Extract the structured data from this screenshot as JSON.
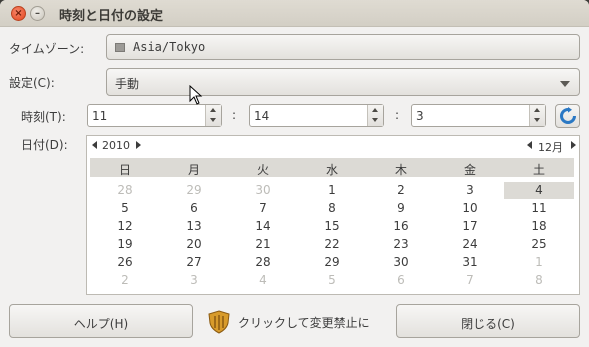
{
  "window": {
    "title": "時刻と日付の設定"
  },
  "timezone": {
    "label": "タイムゾーン:",
    "value": "Asia/Tokyo"
  },
  "setting": {
    "label": "設定(C):",
    "value": "手動"
  },
  "time": {
    "label": "時刻(T):",
    "hours": "11",
    "minutes": "14",
    "seconds": "3",
    "separator": ":"
  },
  "date": {
    "label": "日付(D):"
  },
  "calendar": {
    "year": "2010",
    "month": "12月",
    "weekdays": [
      "日",
      "月",
      "火",
      "水",
      "木",
      "金",
      "土"
    ],
    "selected_day": "4",
    "weeks": [
      [
        {
          "d": "28",
          "o": 1
        },
        {
          "d": "29",
          "o": 1
        },
        {
          "d": "30",
          "o": 1
        },
        {
          "d": "1",
          "o": 0
        },
        {
          "d": "2",
          "o": 0
        },
        {
          "d": "3",
          "o": 0
        },
        {
          "d": "4",
          "o": 0
        }
      ],
      [
        {
          "d": "5",
          "o": 0
        },
        {
          "d": "6",
          "o": 0
        },
        {
          "d": "7",
          "o": 0
        },
        {
          "d": "8",
          "o": 0
        },
        {
          "d": "9",
          "o": 0
        },
        {
          "d": "10",
          "o": 0
        },
        {
          "d": "11",
          "o": 0
        }
      ],
      [
        {
          "d": "12",
          "o": 0
        },
        {
          "d": "13",
          "o": 0
        },
        {
          "d": "14",
          "o": 0
        },
        {
          "d": "15",
          "o": 0
        },
        {
          "d": "16",
          "o": 0
        },
        {
          "d": "17",
          "o": 0
        },
        {
          "d": "18",
          "o": 0
        }
      ],
      [
        {
          "d": "19",
          "o": 0
        },
        {
          "d": "20",
          "o": 0
        },
        {
          "d": "21",
          "o": 0
        },
        {
          "d": "22",
          "o": 0
        },
        {
          "d": "23",
          "o": 0
        },
        {
          "d": "24",
          "o": 0
        },
        {
          "d": "25",
          "o": 0
        }
      ],
      [
        {
          "d": "26",
          "o": 0
        },
        {
          "d": "27",
          "o": 0
        },
        {
          "d": "28",
          "o": 0
        },
        {
          "d": "29",
          "o": 0
        },
        {
          "d": "30",
          "o": 0
        },
        {
          "d": "31",
          "o": 0
        },
        {
          "d": "1",
          "o": 1
        }
      ],
      [
        {
          "d": "2",
          "o": 1
        },
        {
          "d": "3",
          "o": 1
        },
        {
          "d": "4",
          "o": 1
        },
        {
          "d": "5",
          "o": 1
        },
        {
          "d": "6",
          "o": 1
        },
        {
          "d": "7",
          "o": 1
        },
        {
          "d": "8",
          "o": 1
        }
      ]
    ]
  },
  "footer": {
    "help": "ヘルプ(H)",
    "lock": "クリックして変更禁止に",
    "close": "閉じる(C)"
  },
  "colors": {
    "close_button": "#e4471f",
    "refresh_icon": "#2a78c4",
    "lock_shield": "#d89b2b"
  }
}
